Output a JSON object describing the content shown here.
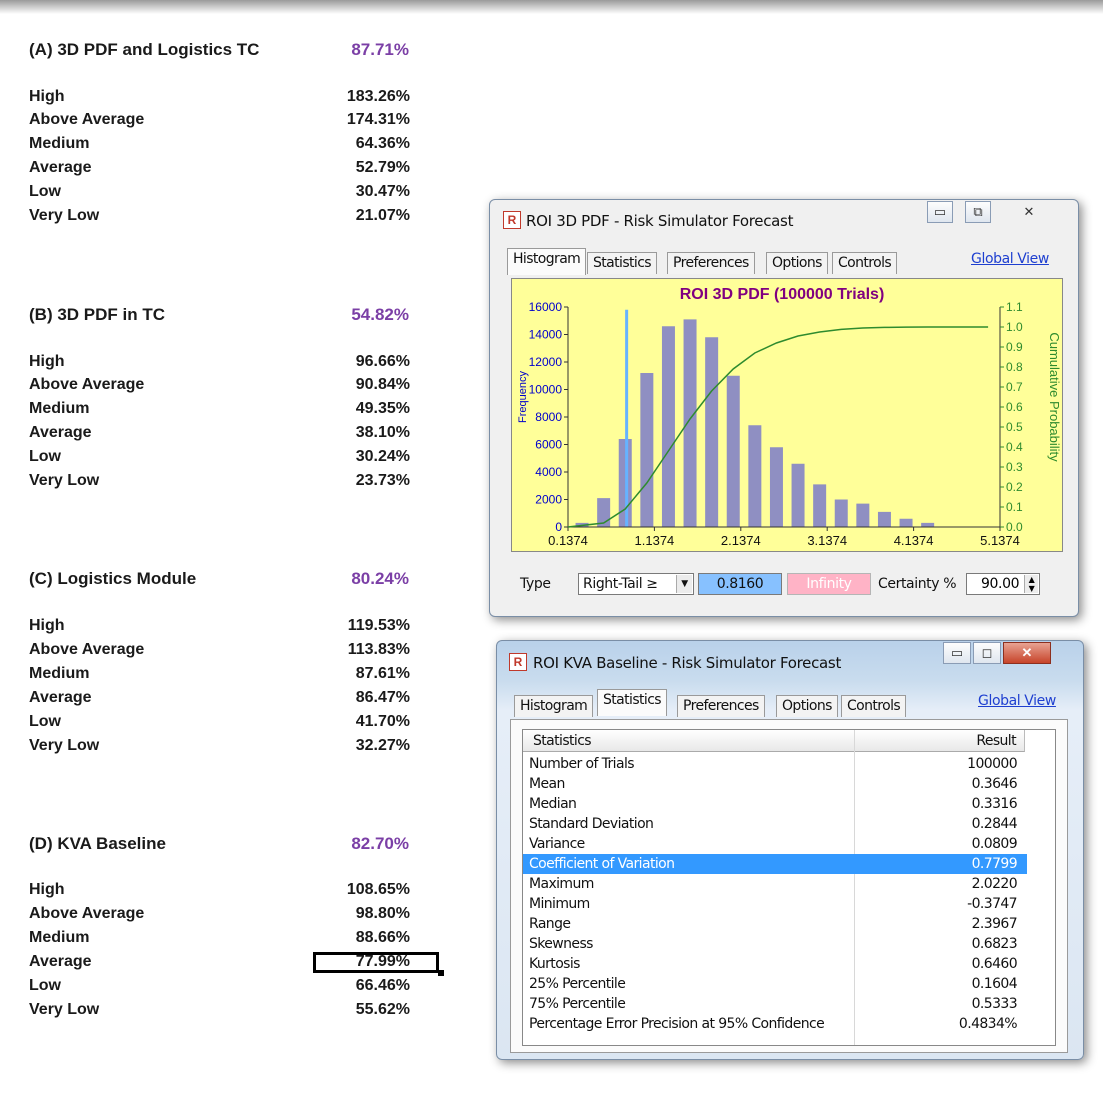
{
  "sections": [
    {
      "title": "(A) 3D PDF and Logistics TC",
      "pct": "87.71%",
      "rows": [
        {
          "label": "High",
          "value": "183.26%"
        },
        {
          "label": "Above Average",
          "value": "174.31%"
        },
        {
          "label": "Medium",
          "value": "64.36%"
        },
        {
          "label": "Average",
          "value": "52.79%"
        },
        {
          "label": "Low",
          "value": "30.47%"
        },
        {
          "label": "Very Low",
          "value": "21.07%"
        }
      ]
    },
    {
      "title": "(B) 3D PDF in TC",
      "pct": "54.82%",
      "rows": [
        {
          "label": "High",
          "value": "96.66%"
        },
        {
          "label": "Above Average",
          "value": "90.84%"
        },
        {
          "label": "Medium",
          "value": "49.35%"
        },
        {
          "label": "Average",
          "value": "38.10%"
        },
        {
          "label": "Low",
          "value": "30.24%"
        },
        {
          "label": "Very Low",
          "value": "23.73%"
        }
      ]
    },
    {
      "title": "(C) Logistics Module",
      "pct": "80.24%",
      "rows": [
        {
          "label": "High",
          "value": "119.53%"
        },
        {
          "label": "Above Average",
          "value": "113.83%"
        },
        {
          "label": "Medium",
          "value": "87.61%"
        },
        {
          "label": "Average",
          "value": "86.47%"
        },
        {
          "label": "Low",
          "value": "41.70%"
        },
        {
          "label": "Very Low",
          "value": "32.27%"
        }
      ]
    },
    {
      "title": "(D) KVA Baseline",
      "pct": "82.70%",
      "rows": [
        {
          "label": "High",
          "value": "108.65%"
        },
        {
          "label": "Above Average",
          "value": "98.80%"
        },
        {
          "label": "Medium",
          "value": "88.66%"
        },
        {
          "label": "Average",
          "value": "77.99%"
        },
        {
          "label": "Low",
          "value": "66.46%"
        },
        {
          "label": "Very Low",
          "value": "55.62%"
        }
      ]
    }
  ],
  "colors": {
    "section_pct": "#7b3fa6",
    "histogram_bg": "#ffff99",
    "bars": "#8f8fc2",
    "cdf_line": "#2e8b2e",
    "certainty_bar": "#66b3ff",
    "selection": "#3399ff"
  },
  "window1": {
    "title": "ROI 3D PDF - Risk Simulator Forecast",
    "icon": "R",
    "tabs": [
      "Histogram",
      "Statistics",
      "Preferences",
      "Options",
      "Controls"
    ],
    "active_tab": "Histogram",
    "global_view": "Global View",
    "controls": {
      "type_label": "Type",
      "type_value": "Right-Tail ≥",
      "lower": "0.8160",
      "upper": "Infinity",
      "certainty_label": "Certainty %",
      "certainty_value": "90.00"
    }
  },
  "chart_data": {
    "type": "bar",
    "title": "ROI 3D PDF (100000 Trials)",
    "ylabel": "Frequency",
    "y2label": "Cumulative Probability",
    "ylim": [
      0,
      16000
    ],
    "y2lim": [
      0,
      1.1
    ],
    "xlim": [
      0.1374,
      5.1374
    ],
    "x_ticks": [
      "0.1374",
      "1.1374",
      "2.1374",
      "3.1374",
      "4.1374",
      "5.1374"
    ],
    "y_ticks": [
      "0",
      "2000",
      "4000",
      "6000",
      "8000",
      "10000",
      "12000",
      "14000",
      "16000"
    ],
    "y2_ticks": [
      "0.0",
      "0.1",
      "0.2",
      "0.3",
      "0.4",
      "0.5",
      "0.6",
      "0.7",
      "0.8",
      "0.9",
      "1.0",
      "1.1"
    ],
    "bins_x": [
      0.3,
      0.55,
      0.8,
      1.05,
      1.3,
      1.55,
      1.8,
      2.05,
      2.3,
      2.55,
      2.8,
      3.05,
      3.3,
      3.55,
      3.8,
      4.05,
      4.3
    ],
    "values": [
      300,
      2100,
      6400,
      11200,
      14600,
      15100,
      13800,
      11000,
      7400,
      5800,
      4600,
      3100,
      2000,
      1700,
      1100,
      600,
      300
    ],
    "certainty_x": 0.816,
    "cdf": [
      [
        0.1374,
        0
      ],
      [
        0.55,
        0.02
      ],
      [
        0.8,
        0.09
      ],
      [
        1.05,
        0.22
      ],
      [
        1.3,
        0.38
      ],
      [
        1.55,
        0.54
      ],
      [
        1.8,
        0.68
      ],
      [
        2.05,
        0.79
      ],
      [
        2.3,
        0.87
      ],
      [
        2.55,
        0.92
      ],
      [
        2.8,
        0.955
      ],
      [
        3.05,
        0.975
      ],
      [
        3.3,
        0.988
      ],
      [
        3.55,
        0.995
      ],
      [
        3.8,
        0.998
      ],
      [
        4.05,
        0.9995
      ],
      [
        4.3,
        1.0
      ],
      [
        5.0,
        1.0
      ]
    ]
  },
  "window2": {
    "title": "ROI KVA Baseline - Risk Simulator Forecast",
    "icon": "R",
    "tabs": [
      "Histogram",
      "Statistics",
      "Preferences",
      "Options",
      "Controls"
    ],
    "active_tab": "Statistics",
    "global_view": "Global View",
    "col_statistics": "Statistics",
    "col_result": "Result",
    "rows": [
      {
        "name": "Number of Trials",
        "value": "100000"
      },
      {
        "name": "Mean",
        "value": "0.3646"
      },
      {
        "name": "Median",
        "value": "0.3316"
      },
      {
        "name": "Standard Deviation",
        "value": "0.2844"
      },
      {
        "name": "Variance",
        "value": "0.0809"
      },
      {
        "name": "Coefficient of Variation",
        "value": "0.7799"
      },
      {
        "name": "Maximum",
        "value": "2.0220"
      },
      {
        "name": "Minimum",
        "value": "-0.3747"
      },
      {
        "name": "Range",
        "value": "2.3967"
      },
      {
        "name": "Skewness",
        "value": "0.6823"
      },
      {
        "name": "Kurtosis",
        "value": "0.6460"
      },
      {
        "name": "25% Percentile",
        "value": "0.1604"
      },
      {
        "name": "75% Percentile",
        "value": "0.5333"
      },
      {
        "name": "Percentage Error Precision at 95% Confidence",
        "value": "0.4834%"
      }
    ],
    "selected_row": "Coefficient of Variation"
  }
}
